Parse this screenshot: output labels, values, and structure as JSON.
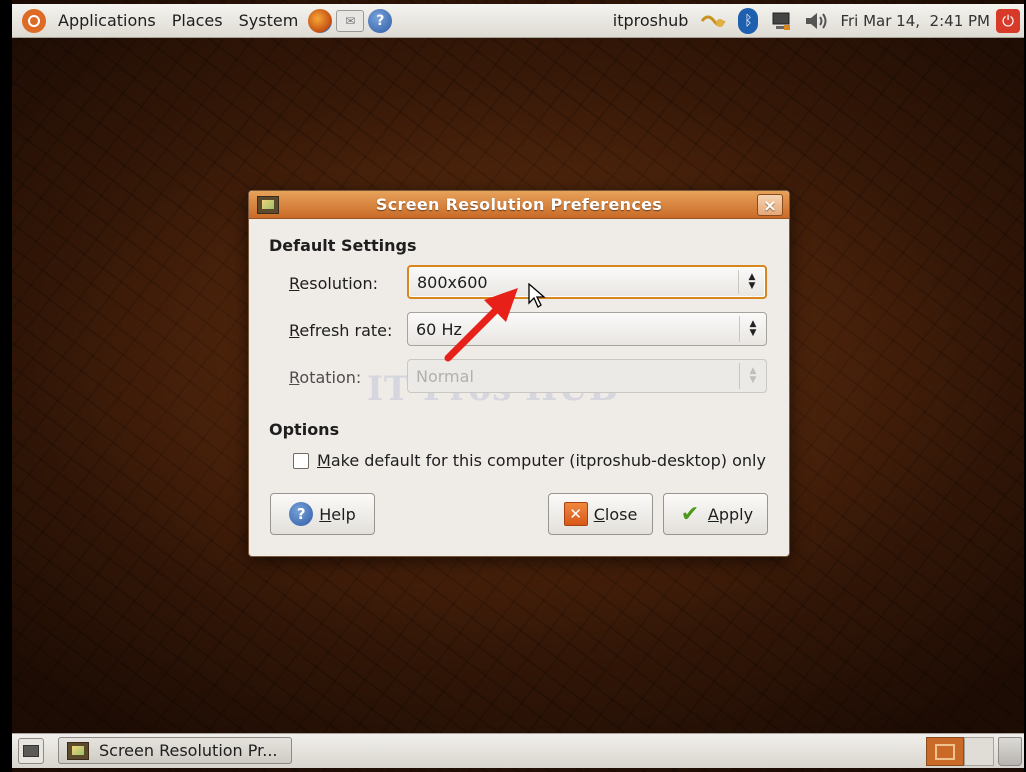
{
  "top_panel": {
    "menus": [
      "Applications",
      "Places",
      "System"
    ],
    "launchers": [
      "firefox-icon",
      "mail-icon",
      "help-icon"
    ],
    "user": "itproshub",
    "clock": "Fri Mar 14,  2:41 PM"
  },
  "dialog": {
    "title": "Screen Resolution Preferences",
    "close_glyph": "×",
    "default_settings_heading": "Default Settings",
    "resolution": {
      "label": "Resolution:",
      "value": "800x600"
    },
    "refresh_rate": {
      "label": "Refresh rate:",
      "value": "60 Hz"
    },
    "rotation": {
      "label": "Rotation:",
      "value": "Normal",
      "disabled": true
    },
    "options_heading": "Options",
    "make_default": {
      "label": "Make default for this computer (itproshub-desktop) only",
      "checked": false
    },
    "buttons": {
      "help": "Help",
      "close": "Close",
      "apply": "Apply"
    },
    "watermark": "IT Pros HUB"
  },
  "bottom_panel": {
    "task_button_label": "Screen Resolution Pr..."
  },
  "colors": {
    "title_bar": "#c96a28",
    "focus_ring": "#d8861f",
    "annotation_arrow": "#e8201a"
  }
}
